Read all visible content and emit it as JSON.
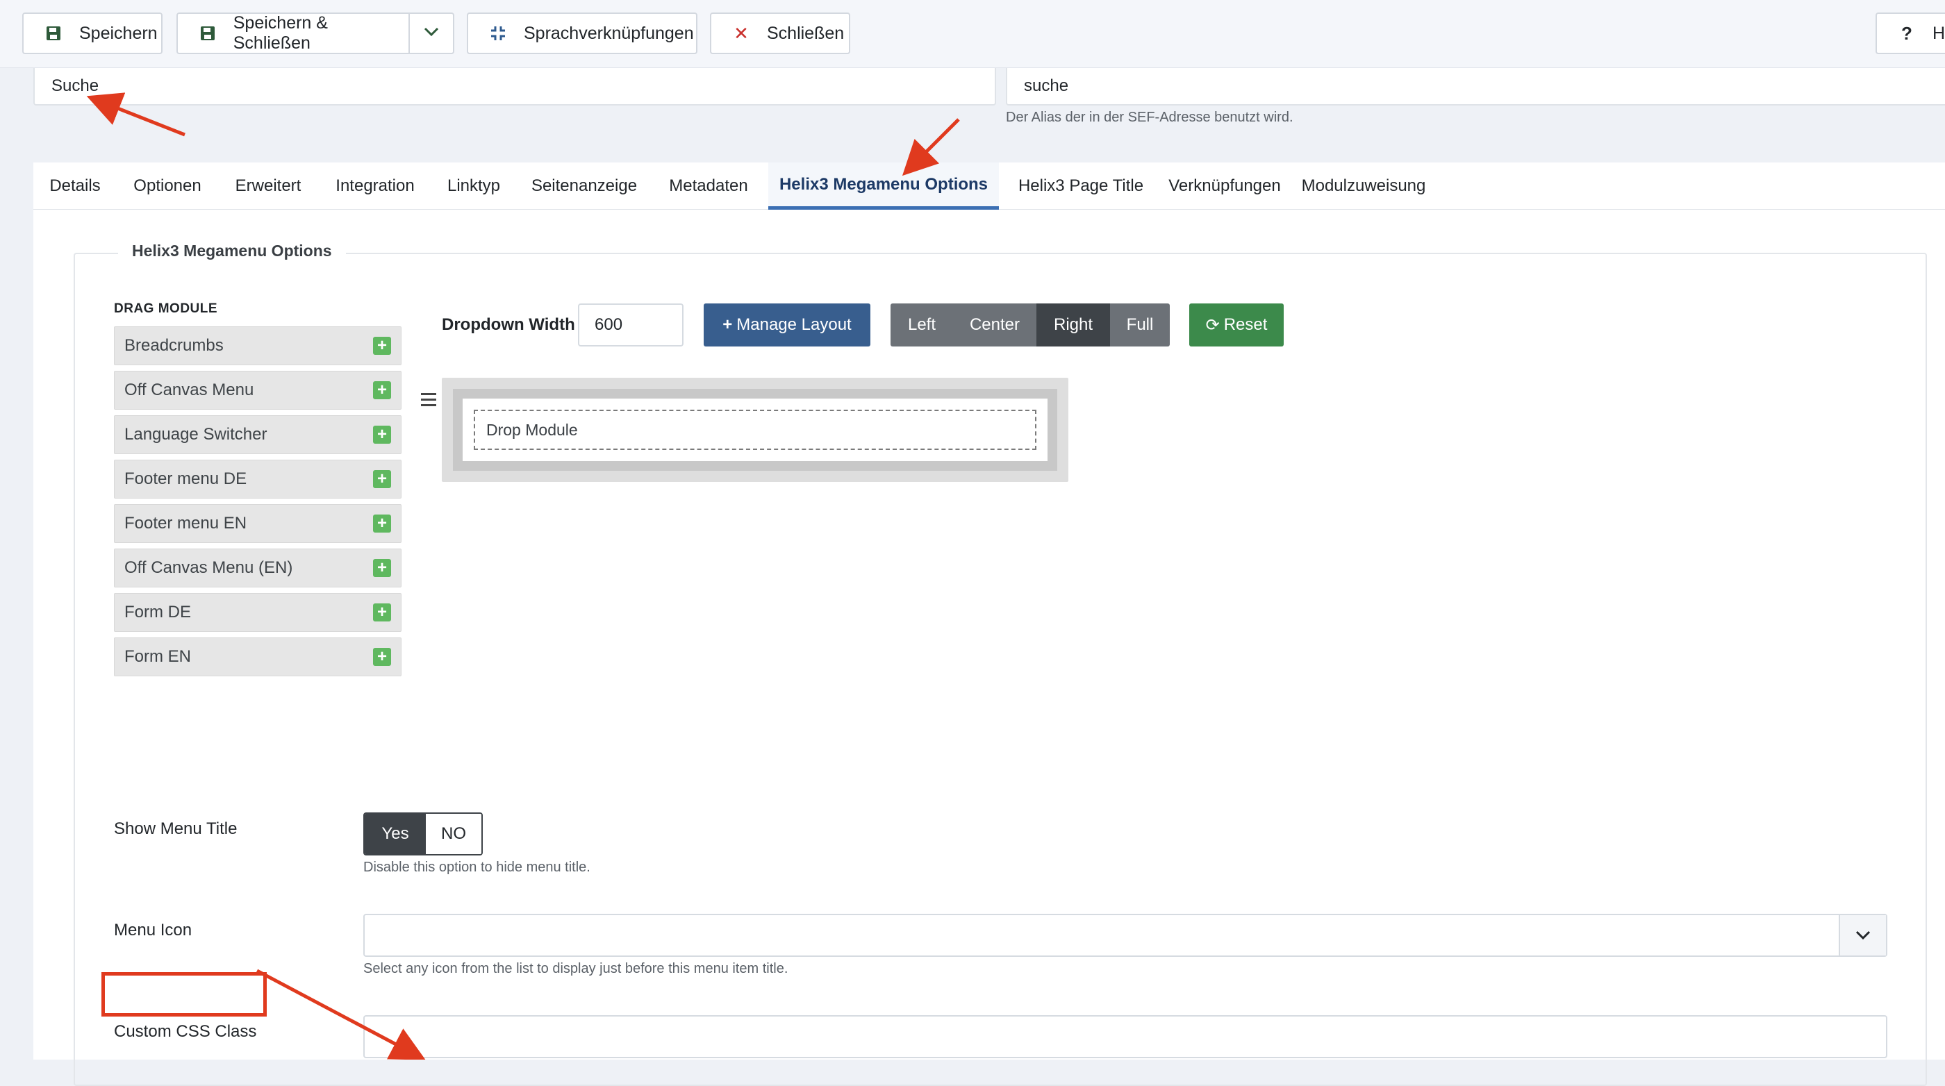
{
  "toolbar": {
    "save": "Speichern",
    "save_close": "Speichern & Schließen",
    "associations": "Sprachverknüpfungen",
    "close": "Schließen",
    "help": "Hi",
    "icons": {
      "save": "save-icon",
      "dropdown": "chevron-down-icon",
      "associations": "compress-icon",
      "close": "close-icon",
      "help": "question-icon"
    }
  },
  "title_field": {
    "value": "Suche"
  },
  "alias_field": {
    "value": "suche",
    "hint": "Der Alias der in der SEF-Adresse benutzt wird."
  },
  "tabs": [
    {
      "label": "Details"
    },
    {
      "label": "Optionen"
    },
    {
      "label": "Erweitert"
    },
    {
      "label": "Integration"
    },
    {
      "label": "Linktyp"
    },
    {
      "label": "Seitenanzeige"
    },
    {
      "label": "Metadaten"
    },
    {
      "label": "Helix3 Megamenu Options",
      "active": true
    },
    {
      "label": "Helix3 Page Title"
    },
    {
      "label": "Verknüpfungen"
    },
    {
      "label": "Modulzuweisung"
    }
  ],
  "megamenu": {
    "legend": "Helix3 Megamenu Options",
    "drag_heading": "DRAG MODULE",
    "modules": [
      "Breadcrumbs",
      "Off Canvas Menu",
      "Language Switcher",
      "Footer menu DE",
      "Footer menu EN",
      "Off Canvas Menu (EN)",
      "Form DE",
      "Form EN"
    ],
    "dropdown_width_label": "Dropdown Width",
    "dropdown_width_value": "600",
    "manage_layout": "Manage Layout",
    "alignment": {
      "options": [
        "Left",
        "Center",
        "Right",
        "Full"
      ],
      "selected": "Right"
    },
    "reset": "Reset",
    "drop_module": "Drop Module"
  },
  "show_menu_title": {
    "label": "Show Menu Title",
    "yes": "Yes",
    "no": "NO",
    "selected": "Yes",
    "hint": "Disable this option to hide menu title."
  },
  "menu_icon": {
    "label": "Menu Icon",
    "value": "",
    "hint": "Select any icon from the list to display just before this menu item title."
  },
  "custom_css_class": {
    "label": "Custom CSS Class",
    "value": ""
  },
  "annotation_color": "#e03a1e",
  "colors": {
    "active_tab": "#3b6fb3",
    "manage_btn": "#385e8e",
    "reset_btn": "#3c8a4b",
    "add_icon": "#5fb85f"
  }
}
